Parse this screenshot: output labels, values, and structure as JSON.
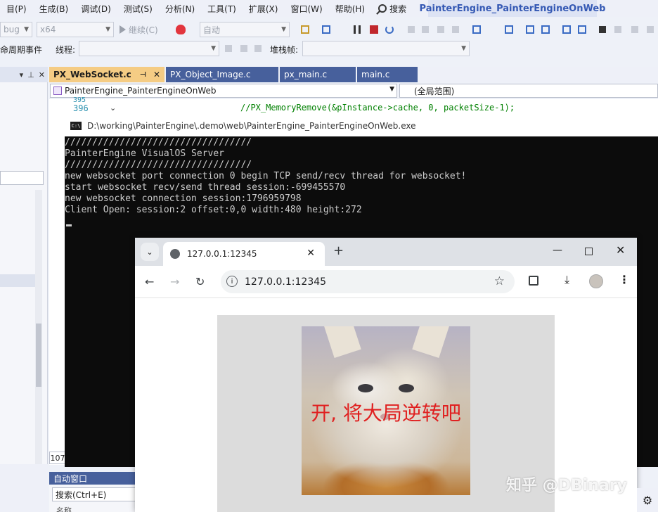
{
  "menubar": {
    "items": [
      "目(P)",
      "生成(B)",
      "调试(D)",
      "测试(S)",
      "分析(N)",
      "工具(T)",
      "扩展(X)",
      "窗口(W)",
      "帮助(H)"
    ],
    "search_label": "搜索",
    "solution_title": "PainterEngine_PainterEngineOnWeb"
  },
  "toolbar": {
    "config": "bug",
    "platform": "x64",
    "continue_label": "继续(C)",
    "auto_label": "自动"
  },
  "debugbar": {
    "lifecycle_label": "命周期事件",
    "thread_label": "线程:",
    "stack_label": "堆栈帧:"
  },
  "tabs": [
    {
      "label": "PX_WebSocket.c",
      "active": true
    },
    {
      "label": "PX_Object_Image.c",
      "active": false
    },
    {
      "label": "px_main.c",
      "active": false
    },
    {
      "label": "main.c",
      "active": false
    }
  ],
  "navbar": {
    "project": "PainterEngine_PainterEngineOnWeb",
    "scope": "(全局范围)"
  },
  "editor": {
    "line_prev": "395",
    "line_number": "396",
    "code": "//PX_MemoryRemove(&pInstance->cache, 0, packetSize-1);",
    "zoom": "107"
  },
  "auto_window": {
    "title": "自动窗口",
    "search_placeholder": "搜索(Ctrl+E)",
    "column_name": "名称"
  },
  "console": {
    "title": "D:\\working\\PainterEngine\\.demo\\web\\PainterEngine_PainterEngineOnWeb.exe",
    "icon_text": "C:\\",
    "lines": "//////////////////////////////////\nPainterEngine VisualOS Server\n//////////////////////////////////\nnew websocket port connection 0 begin TCP send/recv thread for websocket!\nstart websocket recv/send thread session:-699455570\nnew websocket connection session:1796959798\nClient Open: session:2 offset:0,0 width:480 height:272"
  },
  "chrome": {
    "tab_title": "127.0.0.1:12345",
    "url": "127.0.0.1:12345",
    "close_glyph": "✕",
    "new_tab_glyph": "+",
    "min_glyph": "—",
    "close_win_glyph": "✕",
    "back_glyph": "←",
    "forward_glyph": "→",
    "reload_glyph": "↻",
    "star_glyph": "☆",
    "download_glyph": "⤓",
    "menu_glyph": "⋮",
    "info_glyph": "i",
    "tab_search_glyph": "⌄"
  },
  "webpage": {
    "caption": "开, 将大局逆转吧"
  },
  "watermark": "知乎 @DBinary",
  "colors": {
    "accent_tab": "#f5cc84",
    "tab_inactive": "#47609c",
    "console_bg": "#0c0c0c",
    "caption_red": "#e02020"
  }
}
